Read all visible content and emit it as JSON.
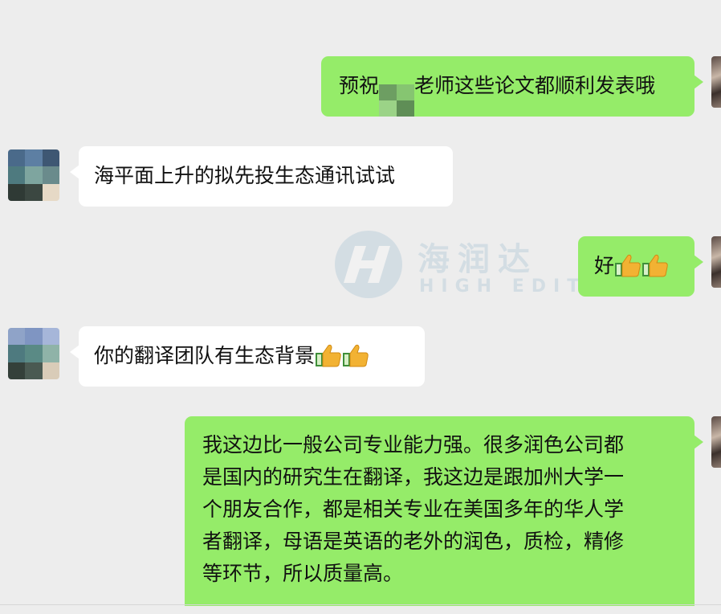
{
  "messages": [
    {
      "id": "m1",
      "direction": "outgoing",
      "text_before": "预祝",
      "text_after": "老师这些论文都顺利发表哦"
    },
    {
      "id": "m2",
      "direction": "incoming",
      "text": "海平面上升的拟先投生态通讯试试"
    },
    {
      "id": "m3",
      "direction": "outgoing",
      "text": "好",
      "emoji": [
        "thumbs-up",
        "thumbs-up"
      ]
    },
    {
      "id": "m4",
      "direction": "incoming",
      "text": "你的翻译团队有生态背景",
      "emoji": [
        "thumbs-up",
        "thumbs-up"
      ]
    },
    {
      "id": "m5",
      "direction": "outgoing",
      "lines": [
        "我这边比一般公司专业能力强。很多润色公司都",
        "是国内的研究生在翻译，我这边是跟加州大学一",
        "个朋友合作，都是相关专业在美国多年的华人学",
        "者翻译，母语是英语的老外的润色，质检，精修",
        "等环节，所以质量高。"
      ]
    }
  ],
  "watermark": {
    "cn": "海润达",
    "en": "HIGH EDIT"
  },
  "colors": {
    "background": "#ededed",
    "outgoing_bubble": "#95ec69",
    "incoming_bubble": "#ffffff",
    "text": "#111111"
  },
  "icons": {
    "emoji": "thumbs-up-emoji",
    "watermark_logo": "h-logo"
  }
}
